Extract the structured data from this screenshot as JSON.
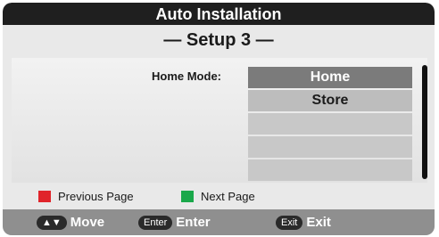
{
  "header": {
    "title": "Auto  Installation",
    "subtitle": "— Setup 3 —"
  },
  "form": {
    "label": "Home Mode:",
    "options": [
      "Home",
      "Store",
      "",
      "",
      ""
    ],
    "selected": "Home"
  },
  "legend": {
    "previous_label": "Previous Page",
    "previous_color": "#e0242a",
    "next_label": "Next Page",
    "next_color": "#1aa84a"
  },
  "keys": [
    {
      "badge": "▲▼",
      "label": "Move",
      "icon": "updown-key-icon"
    },
    {
      "badge": "Enter",
      "label": "Enter",
      "icon": "enter-key-icon"
    },
    {
      "badge": "Exit",
      "label": "Exit",
      "icon": "exit-key-icon"
    }
  ]
}
